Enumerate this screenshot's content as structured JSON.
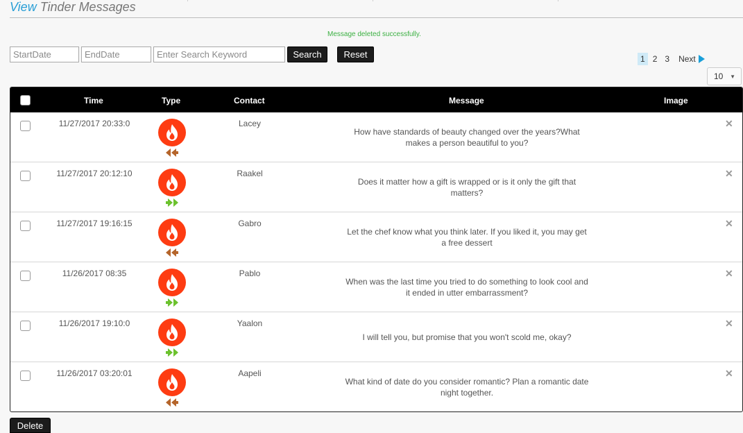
{
  "page": {
    "title_accent": "View",
    "title_rest": " Tinder Messages",
    "flash_message": "Message deleted successfully."
  },
  "filters": {
    "start_placeholder": "StartDate",
    "end_placeholder": "EndDate",
    "search_placeholder": "Enter Search Keyword",
    "search_label": "Search",
    "reset_label": "Reset"
  },
  "pagination": {
    "pages": [
      "1",
      "2",
      "3"
    ],
    "active_page": "1",
    "next_label": "Next"
  },
  "per_page": {
    "value": "10"
  },
  "table": {
    "headers": {
      "time": "Time",
      "type": "Type",
      "contact": "Contact",
      "message": "Message",
      "image": "Image"
    },
    "rows": [
      {
        "time": "11/27/2017 20:33:0",
        "direction": "incoming",
        "contact": "Lacey",
        "message": "How have standards of beauty changed over the years?What makes a person beautiful to you?"
      },
      {
        "time": "11/27/2017 20:12:10",
        "direction": "outgoing",
        "contact": "Raakel",
        "message": "Does it matter how a gift is wrapped or is it only the gift that matters?"
      },
      {
        "time": "11/27/2017 19:16:15",
        "direction": "incoming",
        "contact": "Gabro",
        "message": "Let the chef know what you think later. If you liked it, you may get a free dessert"
      },
      {
        "time": "11/26/2017 08:35",
        "direction": "outgoing",
        "contact": "Pablo",
        "message": "When was the last time you tried to do something to look cool and it ended in utter embarrassment?"
      },
      {
        "time": "11/26/2017 19:10:0",
        "direction": "outgoing",
        "contact": "Yaalon",
        "message": "I will tell you, but promise that you won't scold me, okay?"
      },
      {
        "time": "11/26/2017 03:20:01",
        "direction": "incoming",
        "contact": "Aapeli",
        "message": "What kind of date do you consider romantic? Plan a romantic date night together."
      }
    ]
  },
  "footer": {
    "delete_label": "Delete"
  },
  "colors": {
    "accent": "#2a9fd6",
    "success": "#3cb043",
    "tinder": "#fe3c12",
    "incoming_arrow": "#b5652b",
    "outgoing_arrow": "#6cc22e"
  },
  "icons": {
    "type_icon": "tinder-flame-icon",
    "incoming": "double-arrow-left-icon",
    "outgoing": "double-arrow-right-icon",
    "delete_row": "close-x-icon"
  }
}
